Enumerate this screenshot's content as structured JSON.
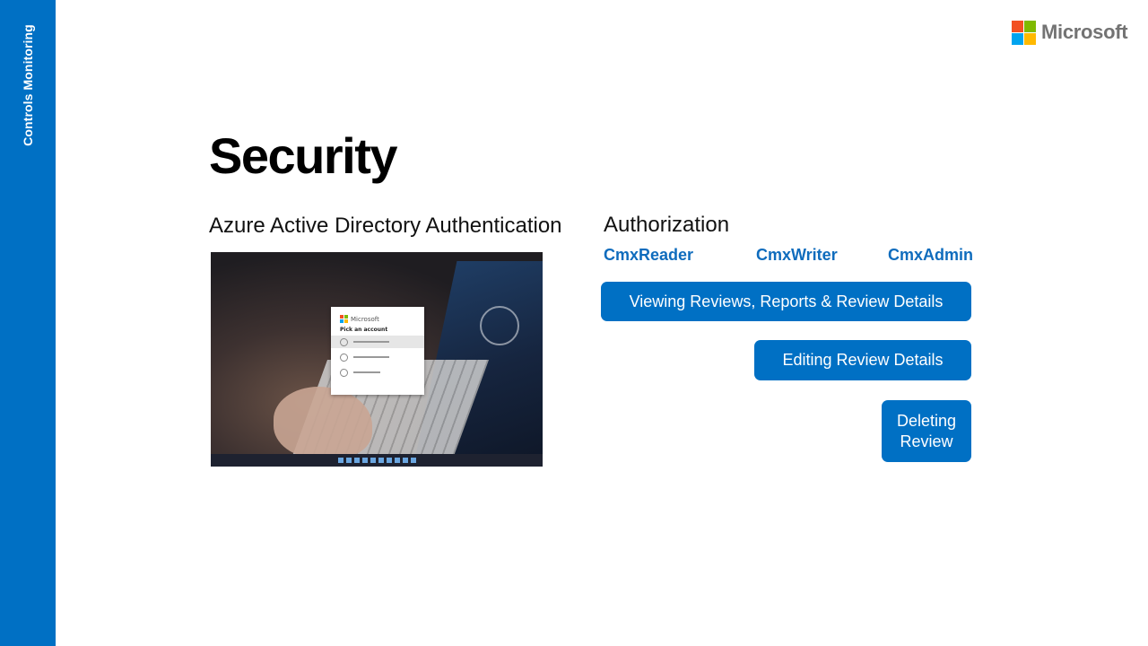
{
  "sidebar": {
    "label": "Controls Monitoring",
    "color": "#0070c4"
  },
  "brand": {
    "name": "Microsoft",
    "squares": [
      "#f25022",
      "#7fba00",
      "#00a4ef",
      "#ffb900"
    ]
  },
  "slide": {
    "title": "Security",
    "authentication": {
      "heading": "Azure Active Directory Authentication",
      "screenshot": {
        "dialog_brand": "Microsoft",
        "dialog_title": "Pick an account"
      }
    },
    "authorization": {
      "heading": "Authorization",
      "roles": [
        "CmxReader",
        "CmxWriter",
        "CmxAdmin"
      ],
      "permissions": [
        "Viewing Reviews, Reports & Review Details",
        "Editing Review Details",
        "Deleting Review"
      ]
    }
  },
  "colors": {
    "accent": "#0070c4",
    "role_text": "#0f6cbd"
  }
}
